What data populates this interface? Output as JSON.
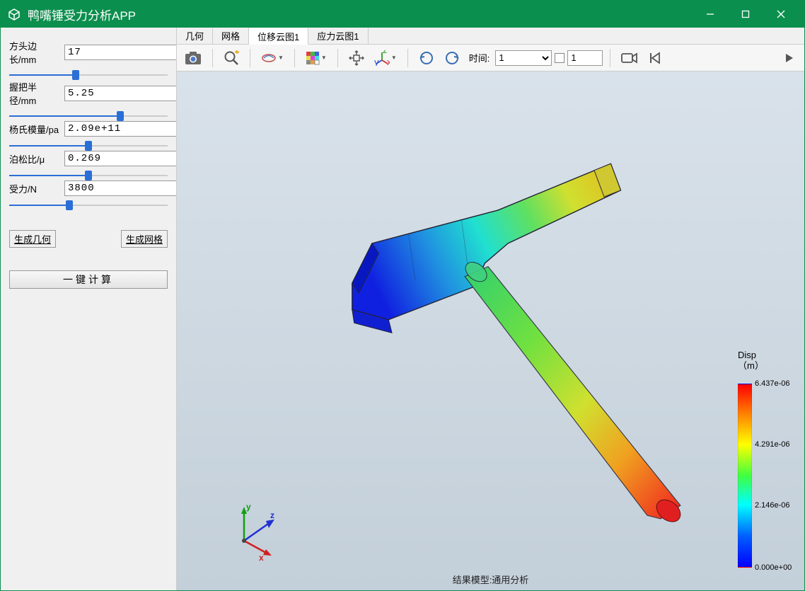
{
  "title": "鸭嘴锤受力分析APP",
  "params": [
    {
      "label": "方头边长/mm",
      "value": "17",
      "fill": 42
    },
    {
      "label": "握把半径/mm",
      "value": "5.25",
      "fill": 70
    },
    {
      "label": "杨氏模量/pa",
      "value": "2.09e+11",
      "fill": 50
    },
    {
      "label": "泊松比/μ",
      "value": "0.269",
      "fill": 50
    },
    {
      "label": "受力/N",
      "value": "3800",
      "fill": 38
    }
  ],
  "buttons": {
    "gen_geom": "生成几何",
    "gen_mesh": "生成网格",
    "compute": "一键计算"
  },
  "tabs": [
    "几何",
    "网格",
    "位移云图1",
    "应力云图1"
  ],
  "active_tab_index": 2,
  "toolbar": {
    "time_label": "时间:",
    "time_value": "1",
    "spin_value": "1"
  },
  "status_text": "结果模型:通用分析",
  "triad": {
    "x": "x",
    "y": "y",
    "z": "z"
  },
  "legend": {
    "title_line1": "Disp",
    "title_line2": "（m）",
    "ticks": [
      {
        "val": "6.437e-06",
        "pos": 0
      },
      {
        "val": "4.291e-06",
        "pos": 33
      },
      {
        "val": "2.146e-06",
        "pos": 66
      },
      {
        "val": "0.000e+00",
        "pos": 100
      }
    ]
  }
}
